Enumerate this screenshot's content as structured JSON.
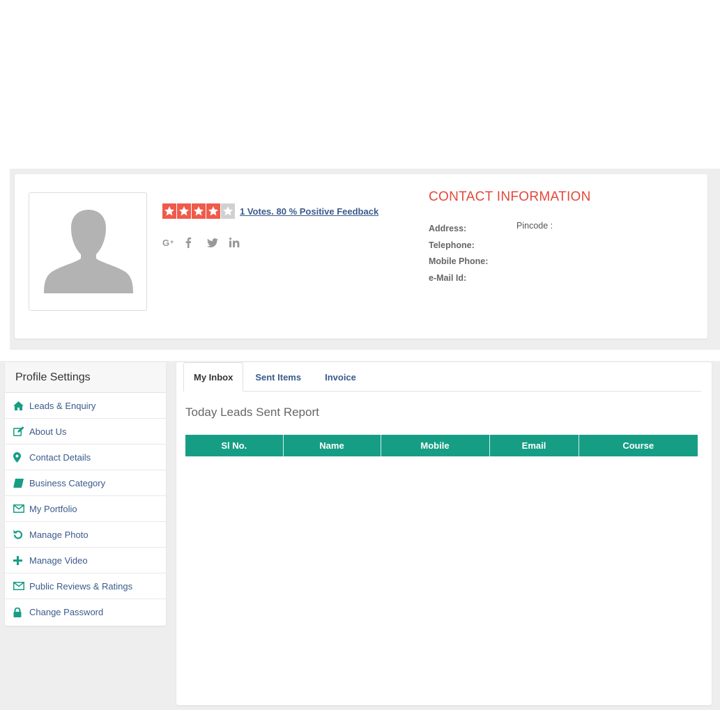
{
  "profile": {
    "rating": {
      "value": 4,
      "max": 5
    },
    "feedback_text": "1 Votes.   80 % Positive Feedback",
    "social": [
      {
        "icon": "google-plus-icon",
        "glyph": "G+"
      },
      {
        "icon": "facebook-icon",
        "glyph": "f"
      },
      {
        "icon": "twitter-icon",
        "glyph": ""
      },
      {
        "icon": "linkedin-icon",
        "glyph": "in"
      }
    ]
  },
  "contact": {
    "title": "CONTACT INFORMATION",
    "address_label": "Address:",
    "telephone_label": "Telephone:",
    "mobile_label": "Mobile Phone:",
    "email_label": "e-Mail Id:",
    "pincode_label": "Pincode :"
  },
  "sidebar": {
    "title": "Profile Settings",
    "items": [
      {
        "label": "Leads & Enquiry",
        "icon": "home-icon"
      },
      {
        "label": "About Us",
        "icon": "edit-icon"
      },
      {
        "label": "Contact Details",
        "icon": "map-marker-icon"
      },
      {
        "label": "Business Category",
        "icon": "book-icon"
      },
      {
        "label": "My Portfolio",
        "icon": "envelope-icon"
      },
      {
        "label": "Manage Photo",
        "icon": "undo-icon"
      },
      {
        "label": "Manage Video",
        "icon": "plus-icon"
      },
      {
        "label": "Public Reviews & Ratings",
        "icon": "envelope-icon"
      },
      {
        "label": "Change Password",
        "icon": "lock-icon"
      }
    ]
  },
  "tabs": {
    "inbox": "My Inbox",
    "sent": "Sent Items",
    "invoice": "Invoice",
    "active": "inbox"
  },
  "report": {
    "title": "Today Leads Sent Report",
    "columns": [
      "Sl No.",
      "Name",
      "Mobile",
      "Email",
      "Course"
    ],
    "rows": []
  },
  "colors": {
    "accent_teal": "#169e85",
    "title_red": "#e2483b",
    "star_on": "#ef5b4b",
    "star_off": "#d0d0d0",
    "link_blue": "#3a5a8c"
  }
}
